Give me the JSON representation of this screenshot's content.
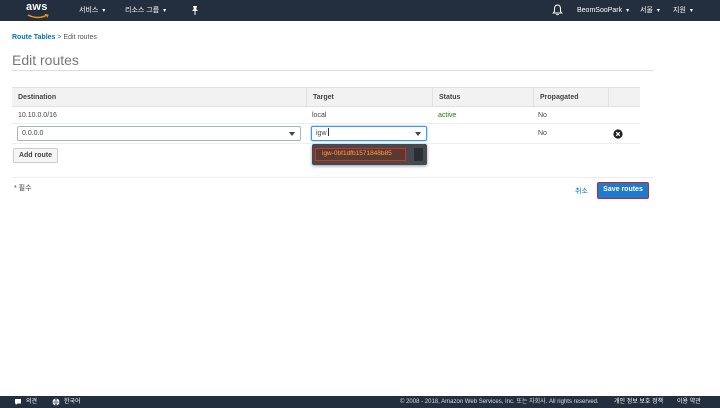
{
  "topnav": {
    "logo": "aws",
    "services": "서비스",
    "resource_groups": "리소스 그룹",
    "user": "BeomSooPark",
    "region": "서울",
    "support": "지원"
  },
  "breadcrumb": {
    "parent": "Route Tables",
    "separator": ">",
    "current": "Edit routes"
  },
  "page_title": "Edit routes",
  "table": {
    "headers": [
      "Destination",
      "Target",
      "Status",
      "Propagated"
    ],
    "static_row": {
      "destination": "10.10.0.0/16",
      "target": "local",
      "status": "active",
      "propagated": "No"
    },
    "edit_row": {
      "destination_value": "0.0.0.0",
      "target_value": "igw",
      "propagated": "No"
    }
  },
  "dropdown": {
    "option": "igw-0bf1dfb1571848b85"
  },
  "buttons": {
    "add_route": "Add route",
    "cancel": "취소",
    "save": "Save routes"
  },
  "required_note": "* 필수",
  "bottombar": {
    "feedback": "의견",
    "language": "한국어",
    "copyright": "© 2008 - 2018, Amazon Web Services, Inc. 또는 자회사. All rights reserved.",
    "privacy": "개인 정보 보호 정책",
    "terms": "이용 약관"
  },
  "colors": {
    "nav_bg": "#232f3e",
    "link": "#0073bb",
    "active_status": "#1d8102",
    "primary_button": "#1f7acc",
    "highlight_outline": "#e02b1c"
  }
}
